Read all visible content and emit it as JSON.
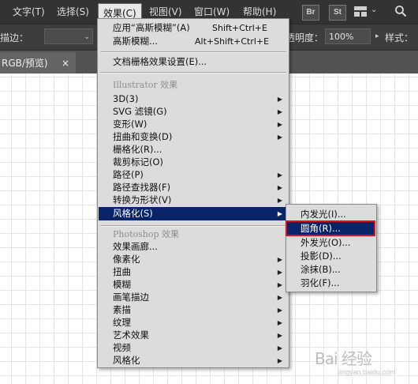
{
  "menubar": {
    "items": [
      "文字(T)",
      "选择(S)",
      "效果(C)",
      "视图(V)",
      "窗口(W)",
      "帮助(H)"
    ],
    "app_icons": [
      "Br",
      "St"
    ]
  },
  "toolbar": {
    "stroke_label": "描边：",
    "opacity_label": "透明度：",
    "opacity_value": "100%",
    "style_label": "样式："
  },
  "tab": {
    "title": "RGB/预览)",
    "close": "×"
  },
  "effect_menu": {
    "apply_last": "应用“高斯模糊”(A)",
    "apply_last_shortcut": "Shift+Ctrl+E",
    "last_effect": "高斯模糊...",
    "last_effect_shortcut": "Alt+Shift+Ctrl+E",
    "raster_settings": "文档栅格效果设置(E)...",
    "illustrator_header": "Illustrator 效果",
    "illustrator_items": [
      "3D(3)",
      "SVG 滤镜(G)",
      "变形(W)",
      "扭曲和变换(D)",
      "栅格化(R)...",
      "裁剪标记(O)",
      "路径(P)",
      "路径查找器(F)",
      "转换为形状(V)",
      "风格化(S)"
    ],
    "photoshop_header": "Photoshop 效果",
    "photoshop_items": [
      "效果画廊...",
      "像素化",
      "扭曲",
      "模糊",
      "画笔描边",
      "素描",
      "纹理",
      "艺术效果",
      "视频",
      "风格化"
    ]
  },
  "stylize_submenu": {
    "items": [
      "内发光(I)...",
      "圆角(R)...",
      "外发光(O)...",
      "投影(D)...",
      "涂抹(B)...",
      "羽化(F)..."
    ],
    "selected": "圆角(R)..."
  },
  "watermark": {
    "logo": "Bai 经验",
    "sub": "jingyan.baidu.com"
  }
}
